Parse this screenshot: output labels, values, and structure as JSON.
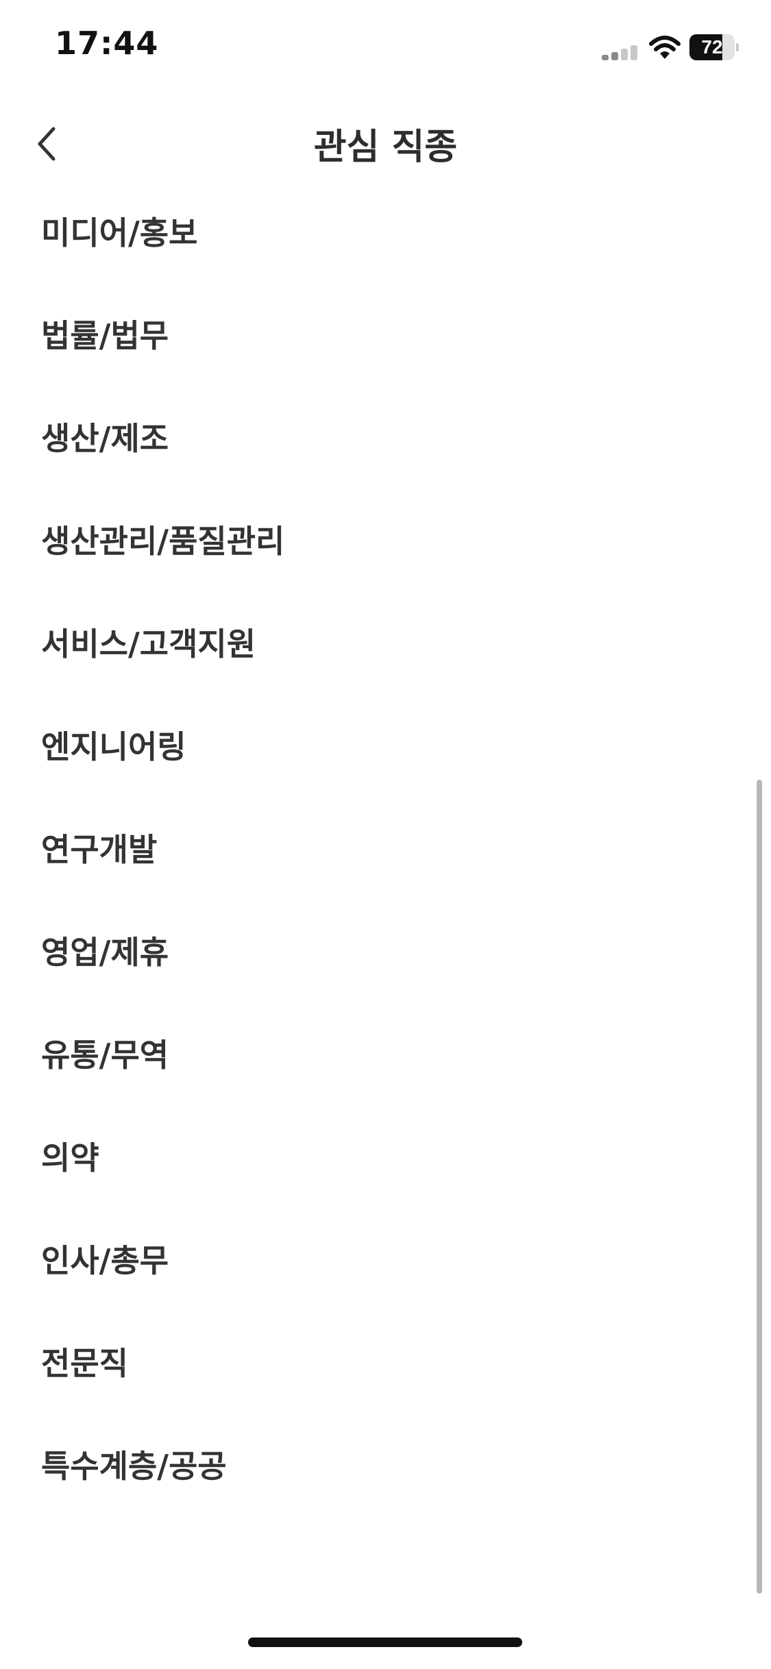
{
  "status_bar": {
    "time": "17:44",
    "battery_percent": "72",
    "battery_level": 0.72,
    "signal_bars_active": 2,
    "signal_bars_total": 4,
    "icons": [
      "cellular-signal-icon",
      "wifi-icon",
      "battery-icon"
    ]
  },
  "nav": {
    "title": "관심 직종",
    "back_icon": "chevron-left-icon"
  },
  "job_list": [
    "미디어/홍보",
    "법률/법무",
    "생산/제조",
    "생산관리/품질관리",
    "서비스/고객지원",
    "엔지니어링",
    "연구개발",
    "영업/제휴",
    "유통/무역",
    "의약",
    "인사/총무",
    "전문직",
    "특수계층/공공"
  ],
  "colors": {
    "background": "#ffffff",
    "text": "#333333",
    "scrollbar": "#b8b8b8"
  }
}
